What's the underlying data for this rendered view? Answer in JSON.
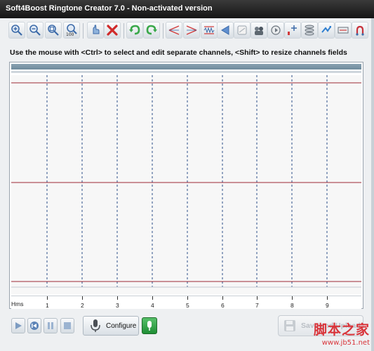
{
  "window": {
    "title": "Soft4Boost Ringtone Creator 7.0 - Non-activated version"
  },
  "toolbar": {
    "buttons": [
      {
        "name": "zoom-in-icon"
      },
      {
        "name": "zoom-out-icon"
      },
      {
        "name": "zoom-fit-icon"
      },
      {
        "name": "zoom-100-icon",
        "label": "100"
      },
      {
        "name": "select-hand-icon"
      },
      {
        "name": "delete-icon"
      },
      {
        "name": "undo-icon"
      },
      {
        "name": "redo-icon"
      },
      {
        "name": "fade-in-icon"
      },
      {
        "name": "fade-out-icon"
      },
      {
        "name": "normalize-icon"
      },
      {
        "name": "reverse-icon"
      },
      {
        "name": "silence-icon"
      },
      {
        "name": "echo-icon"
      },
      {
        "name": "tempo-icon"
      },
      {
        "name": "amplify-icon"
      },
      {
        "name": "equalizer-icon"
      },
      {
        "name": "invert-icon"
      },
      {
        "name": "chorus-icon"
      },
      {
        "name": "effects-icon"
      }
    ]
  },
  "instruction": "Use the mouse with <Ctrl> to select and edit separate channels, <Shift> to resize channels fields",
  "timeline": {
    "unit_label": "Hms",
    "ticks": [
      "1",
      "2",
      "3",
      "4",
      "5",
      "6",
      "7",
      "8",
      "9"
    ]
  },
  "controls": {
    "configure_label": "Configure",
    "save_label": "Save and Upload"
  },
  "watermark": {
    "text": "脚本之家",
    "url": "www.jb51.net"
  },
  "colors": {
    "accent_red": "#9e2a34",
    "grid_blue": "#2d4f8a",
    "record_green": "#1e8e35"
  }
}
